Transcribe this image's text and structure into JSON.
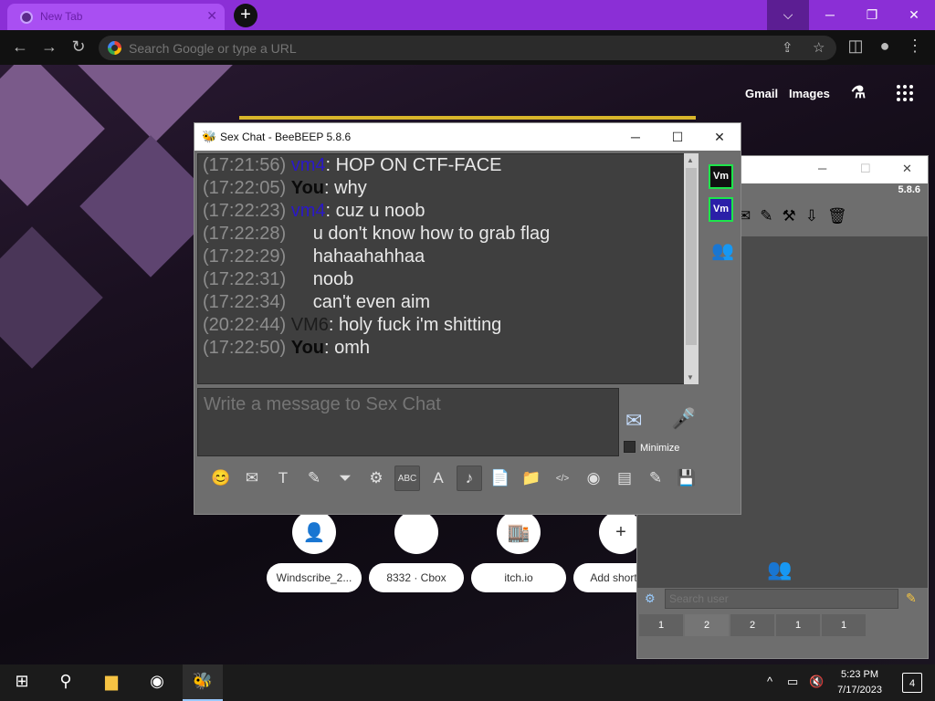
{
  "browser": {
    "tab_title": "New Tab",
    "tab_close": "✕",
    "new_tab": "+",
    "window_buttons": [
      "⌵",
      "─",
      "❐",
      "✕"
    ],
    "omnibox_placeholder": "Search Google or type a URL",
    "nav": {
      "back": "←",
      "forward": "→",
      "reload": "↻"
    },
    "toolbar_icons": [
      "share-icon",
      "star-icon",
      "sidepanel-icon",
      "profile-icon",
      "menu-icon"
    ]
  },
  "ntp": {
    "links": [
      "Gmail",
      "Images"
    ],
    "shortcuts": [
      {
        "label": "Windscribe_2...",
        "icon": "👤"
      },
      {
        "label": "8332 · Cbox",
        "icon": ""
      },
      {
        "label": "itch.io",
        "icon": "🏬"
      },
      {
        "label": "Add shortcut",
        "icon": "+"
      }
    ]
  },
  "chat_window": {
    "title": "Sex Chat - BeeBEEP 5.8.6",
    "window_buttons": [
      "─",
      "☐",
      "✕"
    ],
    "messages": [
      {
        "time": "(17:21:56)",
        "user": "vm4",
        "user_class": "u-vm4",
        "sep": ":",
        "text": " HOP ON CTF-FACE"
      },
      {
        "time": "(17:22:05)",
        "user": "You",
        "user_class": "u-you",
        "sep": ":",
        "text": " why"
      },
      {
        "time": "(17:22:23)",
        "user": "vm4",
        "user_class": "u-vm4",
        "sep": ":",
        "text": " cuz u noob"
      },
      {
        "time": "(17:22:28)",
        "user": "",
        "user_class": "",
        "sep": "",
        "text": "u don't know how to grab flag"
      },
      {
        "time": "(17:22:29)",
        "user": "",
        "user_class": "",
        "sep": "",
        "text": "hahaahahhaa"
      },
      {
        "time": "(17:22:31)",
        "user": "",
        "user_class": "",
        "sep": "",
        "text": "noob"
      },
      {
        "time": "(17:22:34)",
        "user": "",
        "user_class": "",
        "sep": "",
        "text": "can't even aim"
      },
      {
        "time": "(20:22:44)",
        "user": "VM6",
        "user_class": "u-vm6",
        "sep": ":",
        "text": " holy fuck i'm shitting"
      },
      {
        "time": "(17:22:50)",
        "user": "You",
        "user_class": "u-you",
        "sep": ":",
        "text": " omh"
      }
    ],
    "members": [
      "Vm",
      "Vm"
    ],
    "compose_placeholder": "Write a message to Sex Chat",
    "minimize_label": "Minimize",
    "toolbar_icons": [
      "😊",
      "✉",
      "T",
      "✎",
      "⏷",
      "⚙",
      "ABC",
      "A",
      "♪",
      "📄",
      "📁",
      "</>",
      "◉",
      "▤",
      "✎",
      "💾"
    ]
  },
  "main_window": {
    "version": "5.8.6",
    "search_placeholder": "Search user",
    "tabs": [
      "1",
      "2",
      "2",
      "1",
      "1"
    ],
    "window_buttons": [
      "─",
      "☐",
      "✕"
    ]
  },
  "taskbar": {
    "time": "5:23 PM",
    "date": "7/17/2023",
    "notifications": "4"
  }
}
